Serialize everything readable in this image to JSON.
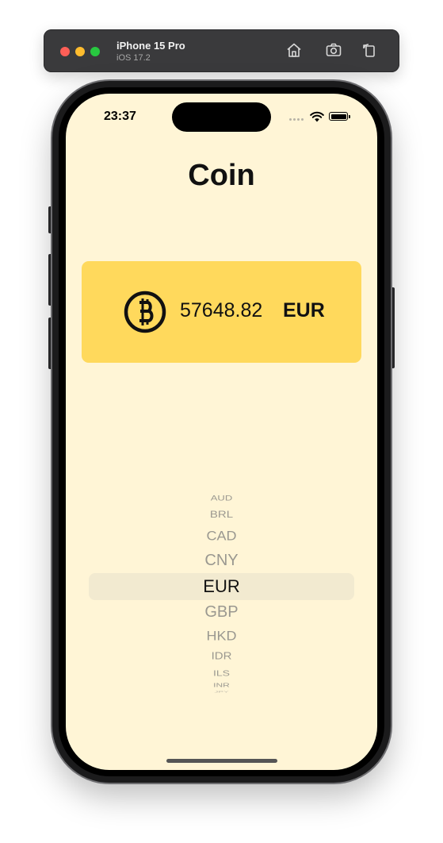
{
  "simulator": {
    "device_name": "iPhone 15 Pro",
    "os_version": "iOS 17.2",
    "toolbar_icons": [
      "home-icon",
      "screenshot-icon",
      "rotate-icon"
    ]
  },
  "status_bar": {
    "time": "23:37"
  },
  "app": {
    "title": "Coin",
    "rate": {
      "icon": "bitcoin-icon",
      "value": "57648.82",
      "currency": "EUR"
    },
    "picker": {
      "selected": "EUR",
      "items": [
        "AUD",
        "BRL",
        "CAD",
        "CNY",
        "EUR",
        "GBP",
        "HKD",
        "IDR",
        "ILS",
        "INR",
        "JPY"
      ]
    }
  },
  "colors": {
    "background": "#fff5d6",
    "card": "#ffd95c",
    "picker_highlight": "#f2ead0"
  }
}
